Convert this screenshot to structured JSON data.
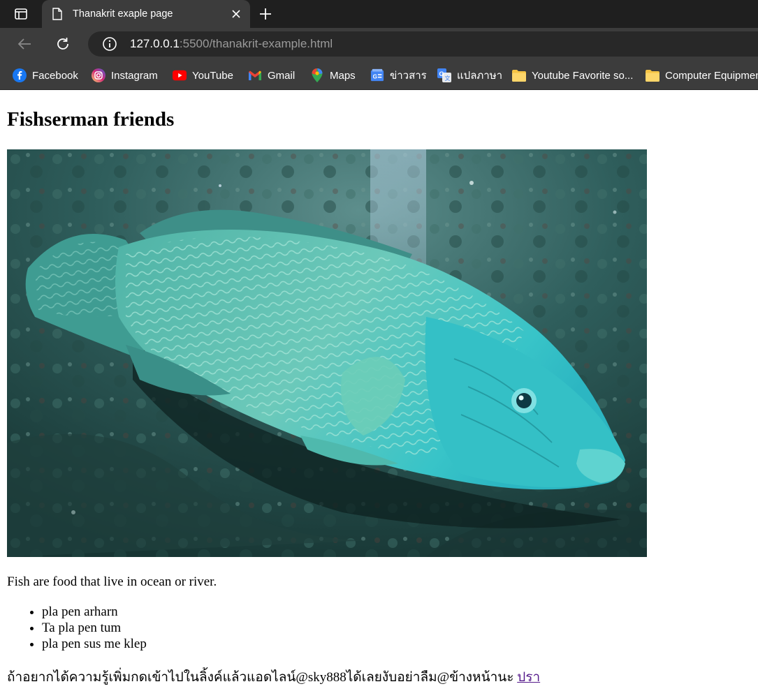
{
  "browser": {
    "tab": {
      "title": "Thanakrit exaple page"
    },
    "address": {
      "host": "127.0.0.1",
      "path": ":5500/thanakrit-example.html"
    },
    "bookmarks": [
      {
        "label": "Facebook",
        "icon": "facebook-icon"
      },
      {
        "label": "Instagram",
        "icon": "instagram-icon"
      },
      {
        "label": "YouTube",
        "icon": "youtube-icon"
      },
      {
        "label": "Gmail",
        "icon": "gmail-icon"
      },
      {
        "label": "Maps",
        "icon": "maps-icon"
      },
      {
        "label": "ข่าวสาร",
        "icon": "google-news-icon"
      },
      {
        "label": "แปลภาษา",
        "icon": "google-translate-icon"
      },
      {
        "label": "Youtube Favorite so...",
        "icon": "folder-icon"
      },
      {
        "label": "Computer Equipmen",
        "icon": "folder-icon"
      }
    ]
  },
  "page": {
    "heading": "Fishserman friends",
    "image": {
      "subject": "humphead wrasse underwater photo"
    },
    "caption": "Fish are food that live in ocean or river.",
    "list": [
      "pla pen arharn",
      "Ta pla pen tum",
      "pla pen sus me klep"
    ],
    "footer": {
      "text": "ถ้าอยากได้ความรู้เพิ่มกดเข้าไปในลิ้งค์แล้วแอดไลน์@sky888ได้เลยงับอย่าลืม@ข้างหน้านะ ",
      "link_label": "ปรา"
    }
  },
  "colors": {
    "tabstrip": "#1f1f1f",
    "toolbar": "#3c3c3c",
    "omnibox": "#282828",
    "visited_link": "#551a8b"
  }
}
